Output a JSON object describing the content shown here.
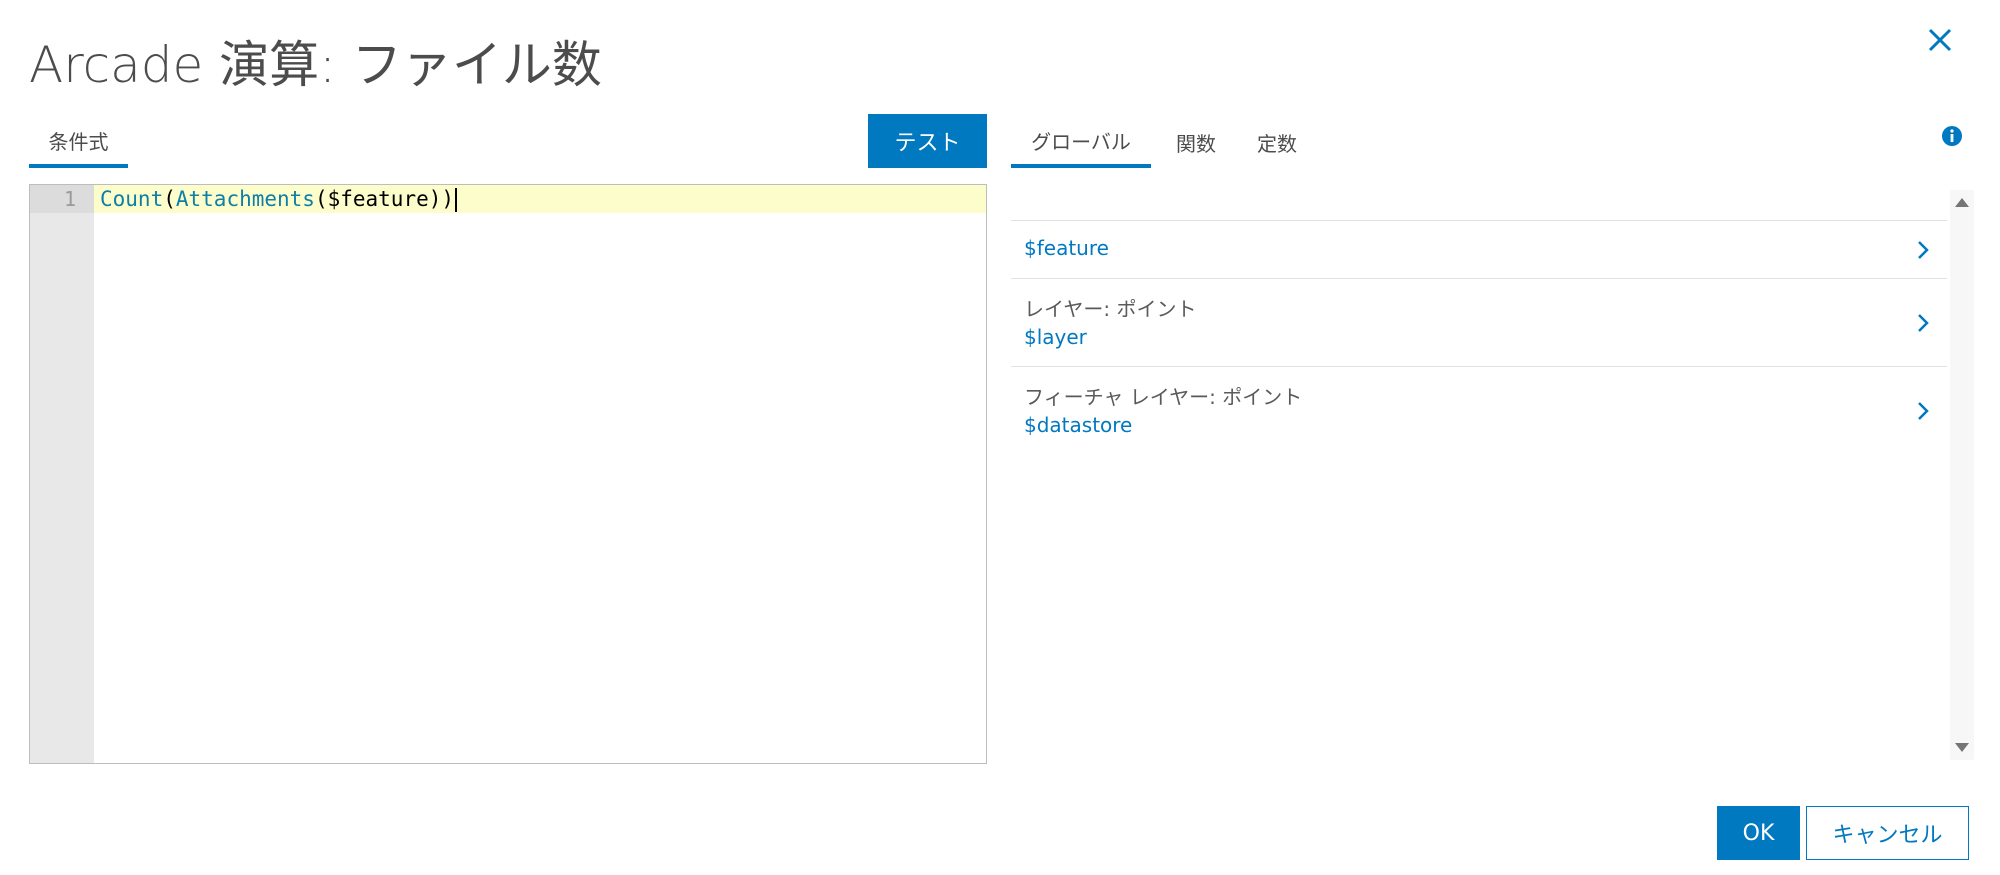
{
  "dialog": {
    "title": "Arcade 演算: ファイル数",
    "close_icon": "close-icon"
  },
  "left_panel": {
    "tab_label": "条件式",
    "test_button": "テスト"
  },
  "editor": {
    "line_number": "1",
    "code_tokens": [
      {
        "text": "Count",
        "kind": "function"
      },
      {
        "text": "(",
        "kind": "plain"
      },
      {
        "text": "Attachments",
        "kind": "function"
      },
      {
        "text": "($feature))",
        "kind": "plain"
      }
    ]
  },
  "right_panel": {
    "tabs": [
      {
        "label": "グローバル",
        "active": true
      },
      {
        "label": "関数",
        "active": false
      },
      {
        "label": "定数",
        "active": false
      }
    ],
    "info_icon": "info-icon",
    "globals": [
      {
        "caption": "",
        "variable": "$feature"
      },
      {
        "caption": "レイヤー: ポイント",
        "variable": "$layer"
      },
      {
        "caption": "フィーチャ レイヤー: ポイント",
        "variable": "$datastore"
      }
    ]
  },
  "footer": {
    "ok_label": "OK",
    "cancel_label": "キャンセル"
  },
  "colors": {
    "accent": "#0079c1",
    "active_line": "#fdfdcc",
    "gutter": "#e8e8e8",
    "code_function": "#0e7fa8"
  }
}
